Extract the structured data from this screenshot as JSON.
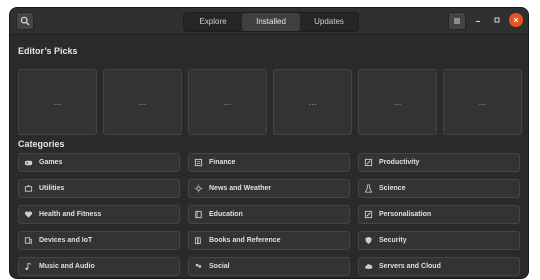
{
  "header": {
    "search_icon": "search-icon",
    "tabs": [
      {
        "label": "Explore"
      },
      {
        "label": "Installed"
      },
      {
        "label": "Updates"
      }
    ],
    "active_tab": "Installed",
    "menu_icon": "hamburger-icon"
  },
  "editors_picks": {
    "title": "Editor’s Picks",
    "loading_indicator": "…"
  },
  "categories": {
    "title": "Categories",
    "items": [
      {
        "label": "Games",
        "icon": "gamepad-icon"
      },
      {
        "label": "Finance",
        "icon": "finance-icon"
      },
      {
        "label": "Productivity",
        "icon": "pencil-icon"
      },
      {
        "label": "Utilities",
        "icon": "toolbox-icon"
      },
      {
        "label": "News and Weather",
        "icon": "sun-icon"
      },
      {
        "label": "Science",
        "icon": "flask-icon"
      },
      {
        "label": "Health and Fitness",
        "icon": "heart-icon"
      },
      {
        "label": "Education",
        "icon": "book-icon"
      },
      {
        "label": "Personalisation",
        "icon": "brush-icon"
      },
      {
        "label": "Devices and IoT",
        "icon": "device-icon"
      },
      {
        "label": "Books and Reference",
        "icon": "books-icon"
      },
      {
        "label": "Security",
        "icon": "shield-icon"
      },
      {
        "label": "Music and Audio",
        "icon": "music-icon"
      },
      {
        "label": "Social",
        "icon": "social-icon"
      },
      {
        "label": "Servers and Cloud",
        "icon": "cloud-icon"
      }
    ]
  },
  "colors": {
    "window_bg": "#2c2c2c",
    "close_button": "#e95420"
  }
}
